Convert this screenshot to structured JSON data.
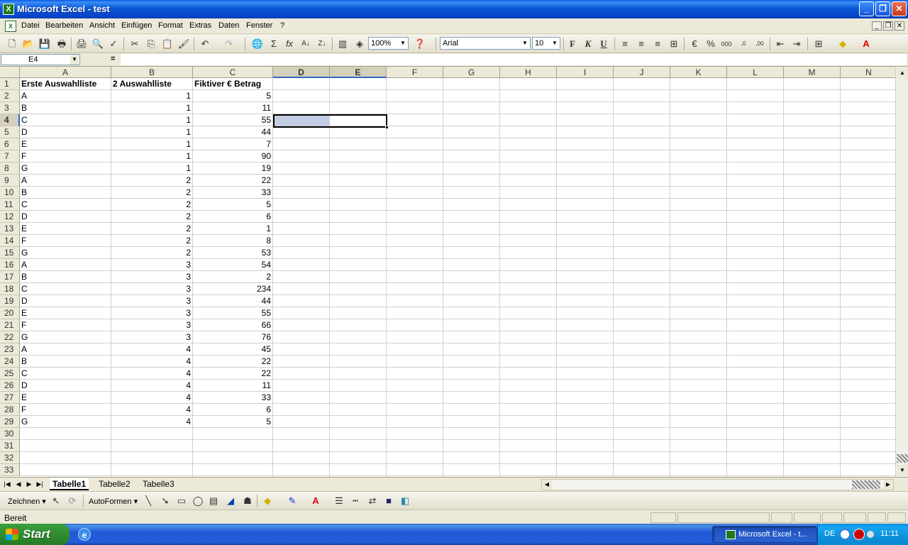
{
  "window": {
    "title": "Microsoft Excel - test",
    "min": "_",
    "max": "❐",
    "close": "✕"
  },
  "menu": {
    "items": [
      "Datei",
      "Bearbeiten",
      "Ansicht",
      "Einfügen",
      "Format",
      "Extras",
      "Daten",
      "Fenster",
      "?"
    ]
  },
  "toolbar": {
    "zoom": "100%",
    "font": "Arial",
    "size": "10",
    "bold": "F",
    "italic": "K",
    "underline": "U"
  },
  "formula": {
    "cell_ref": "E4",
    "eq": "=",
    "value": ""
  },
  "columns": [
    "A",
    "B",
    "C",
    "D",
    "E",
    "F",
    "G",
    "H",
    "I",
    "J",
    "K",
    "L",
    "M",
    "N"
  ],
  "rows": [
    "1",
    "2",
    "3",
    "4",
    "5",
    "6",
    "7",
    "8",
    "9",
    "10",
    "11",
    "12",
    "13",
    "14",
    "15",
    "16",
    "17",
    "18",
    "19",
    "20",
    "21",
    "22",
    "23",
    "24",
    "25",
    "26",
    "27",
    "28",
    "29",
    "30",
    "31",
    "32",
    "33"
  ],
  "table": {
    "headers": [
      "Erste Auswahlliste",
      "2 Auswahlliste",
      "Fiktiver € Betrag"
    ],
    "rows": [
      [
        "A",
        "1",
        "5"
      ],
      [
        "B",
        "1",
        "11"
      ],
      [
        "C",
        "1",
        "55"
      ],
      [
        "D",
        "1",
        "44"
      ],
      [
        "E",
        "1",
        "7"
      ],
      [
        "F",
        "1",
        "90"
      ],
      [
        "G",
        "1",
        "19"
      ],
      [
        "A",
        "2",
        "22"
      ],
      [
        "B",
        "2",
        "33"
      ],
      [
        "C",
        "2",
        "5"
      ],
      [
        "D",
        "2",
        "6"
      ],
      [
        "E",
        "2",
        "1"
      ],
      [
        "F",
        "2",
        "8"
      ],
      [
        "G",
        "2",
        "53"
      ],
      [
        "A",
        "3",
        "54"
      ],
      [
        "B",
        "3",
        "2"
      ],
      [
        "C",
        "3",
        "234"
      ],
      [
        "D",
        "3",
        "44"
      ],
      [
        "E",
        "3",
        "55"
      ],
      [
        "F",
        "3",
        "66"
      ],
      [
        "G",
        "3",
        "76"
      ],
      [
        "A",
        "4",
        "45"
      ],
      [
        "B",
        "4",
        "22"
      ],
      [
        "C",
        "4",
        "22"
      ],
      [
        "D",
        "4",
        "11"
      ],
      [
        "E",
        "4",
        "33"
      ],
      [
        "F",
        "4",
        "6"
      ],
      [
        "G",
        "4",
        "5"
      ]
    ]
  },
  "sheets": [
    "Tabelle1",
    "Tabelle2",
    "Tabelle3"
  ],
  "drawbar": {
    "zeichnen": "Zeichnen ▾",
    "autoformen": "AutoFormen ▾"
  },
  "status": {
    "text": "Bereit"
  },
  "taskbar": {
    "start": "Start",
    "task": "Microsoft Excel - t...",
    "lang": "DE",
    "clock": "11:11"
  }
}
